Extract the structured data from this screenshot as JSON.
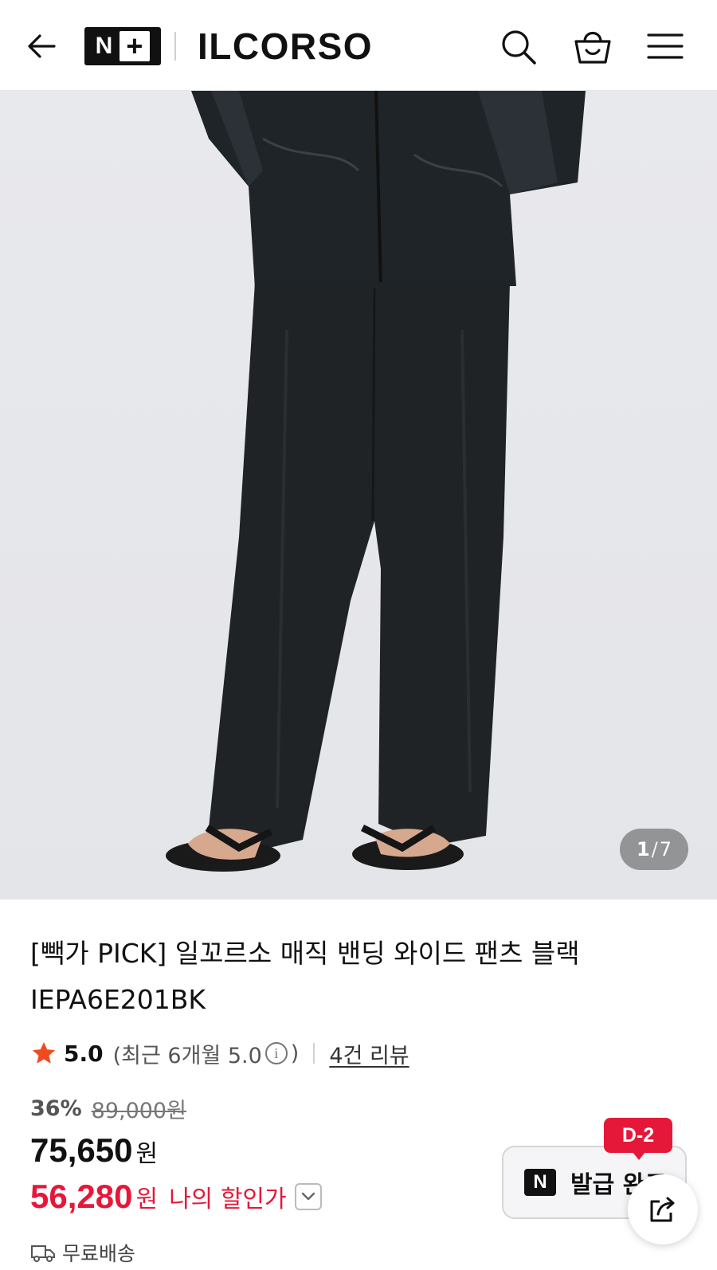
{
  "header": {
    "back_icon": "arrow-left-icon",
    "logo_n": "N",
    "logo_plus": "+",
    "brand": "ILCORSO",
    "search_icon": "search-icon",
    "cart_icon": "shopping-bag-icon",
    "menu_icon": "hamburger-menu-icon"
  },
  "gallery": {
    "current": "1",
    "separator": "/",
    "total": "7"
  },
  "product": {
    "title": "[빽가 PICK] 일꼬르소 매직 밴딩 와이드 팬츠 블랙 IEPA6E201BK"
  },
  "rating": {
    "score": "5.0",
    "recent_prefix": "(최근 6개월 5.0",
    "info_symbol": "i",
    "recent_suffix": ")",
    "review_link": "4건 리뷰"
  },
  "price": {
    "discount_rate": "36%",
    "original": "89,000원",
    "sale_amount": "75,650",
    "sale_unit": "원",
    "my_amount": "56,280",
    "my_unit": "원",
    "my_label": "나의 할인가"
  },
  "shipping": {
    "label": "무료배송"
  },
  "coupon": {
    "badge": "D-2",
    "icon_letter": "N",
    "label": "발급 완료"
  },
  "colors": {
    "accent_red": "#e5183a",
    "text_dark": "#111111",
    "image_bg": "#e6e7ea"
  }
}
